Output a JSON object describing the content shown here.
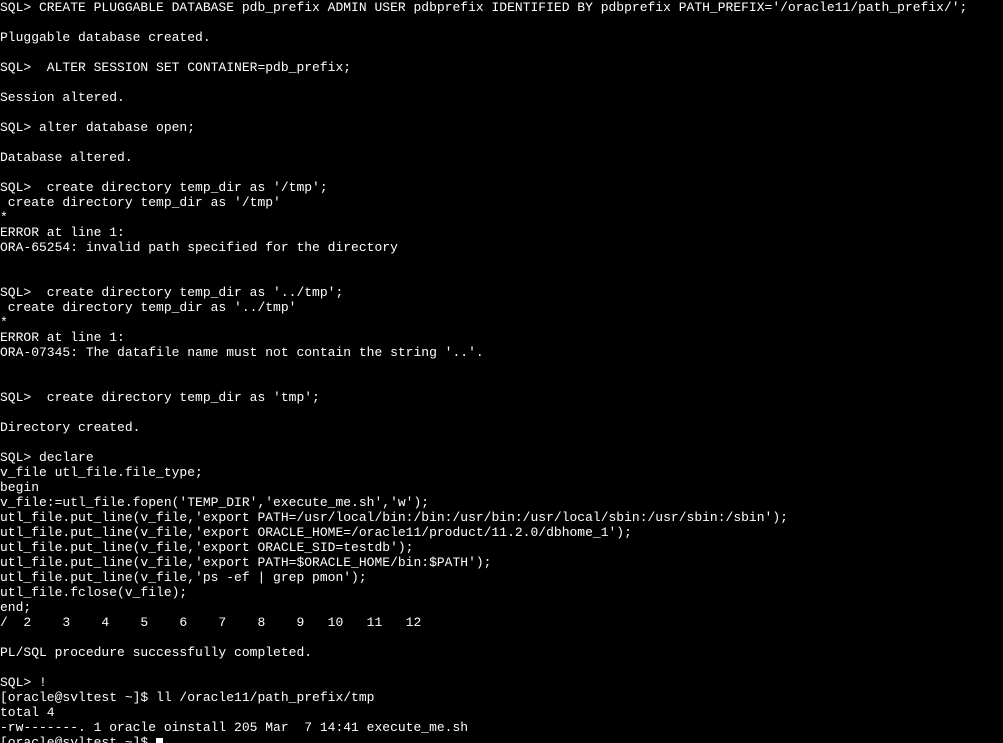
{
  "lines": [
    "SQL> CREATE PLUGGABLE DATABASE pdb_prefix ADMIN USER pdbprefix IDENTIFIED BY pdbprefix PATH_PREFIX='/oracle11/path_prefix/';",
    "",
    "Pluggable database created.",
    "",
    "SQL>  ALTER SESSION SET CONTAINER=pdb_prefix;",
    "",
    "Session altered.",
    "",
    "SQL> alter database open;",
    "",
    "Database altered.",
    "",
    "SQL>  create directory temp_dir as '/tmp';",
    " create directory temp_dir as '/tmp'",
    "*",
    "ERROR at line 1:",
    "ORA-65254: invalid path specified for the directory",
    "",
    "",
    "SQL>  create directory temp_dir as '../tmp';",
    " create directory temp_dir as '../tmp'",
    "*",
    "ERROR at line 1:",
    "ORA-07345: The datafile name must not contain the string '..'.",
    "",
    "",
    "SQL>  create directory temp_dir as 'tmp';",
    "",
    "Directory created.",
    "",
    "SQL> declare",
    "v_file utl_file.file_type;",
    "begin",
    "v_file:=utl_file.fopen('TEMP_DIR','execute_me.sh','w');",
    "utl_file.put_line(v_file,'export PATH=/usr/local/bin:/bin:/usr/bin:/usr/local/sbin:/usr/sbin:/sbin');",
    "utl_file.put_line(v_file,'export ORACLE_HOME=/oracle11/product/11.2.0/dbhome_1');",
    "utl_file.put_line(v_file,'export ORACLE_SID=testdb');",
    "utl_file.put_line(v_file,'export PATH=$ORACLE_HOME/bin:$PATH');",
    "utl_file.put_line(v_file,'ps -ef | grep pmon');",
    "utl_file.fclose(v_file);",
    "end;",
    "/  2    3    4    5    6    7    8    9   10   11   12  ",
    "",
    "PL/SQL procedure successfully completed.",
    "",
    "SQL> !",
    "[oracle@svltest ~]$ ll /oracle11/path_prefix/tmp",
    "total 4",
    "-rw-------. 1 oracle oinstall 205 Mar  7 14:41 execute_me.sh"
  ],
  "prompt_line": "[oracle@svltest ~]$ "
}
